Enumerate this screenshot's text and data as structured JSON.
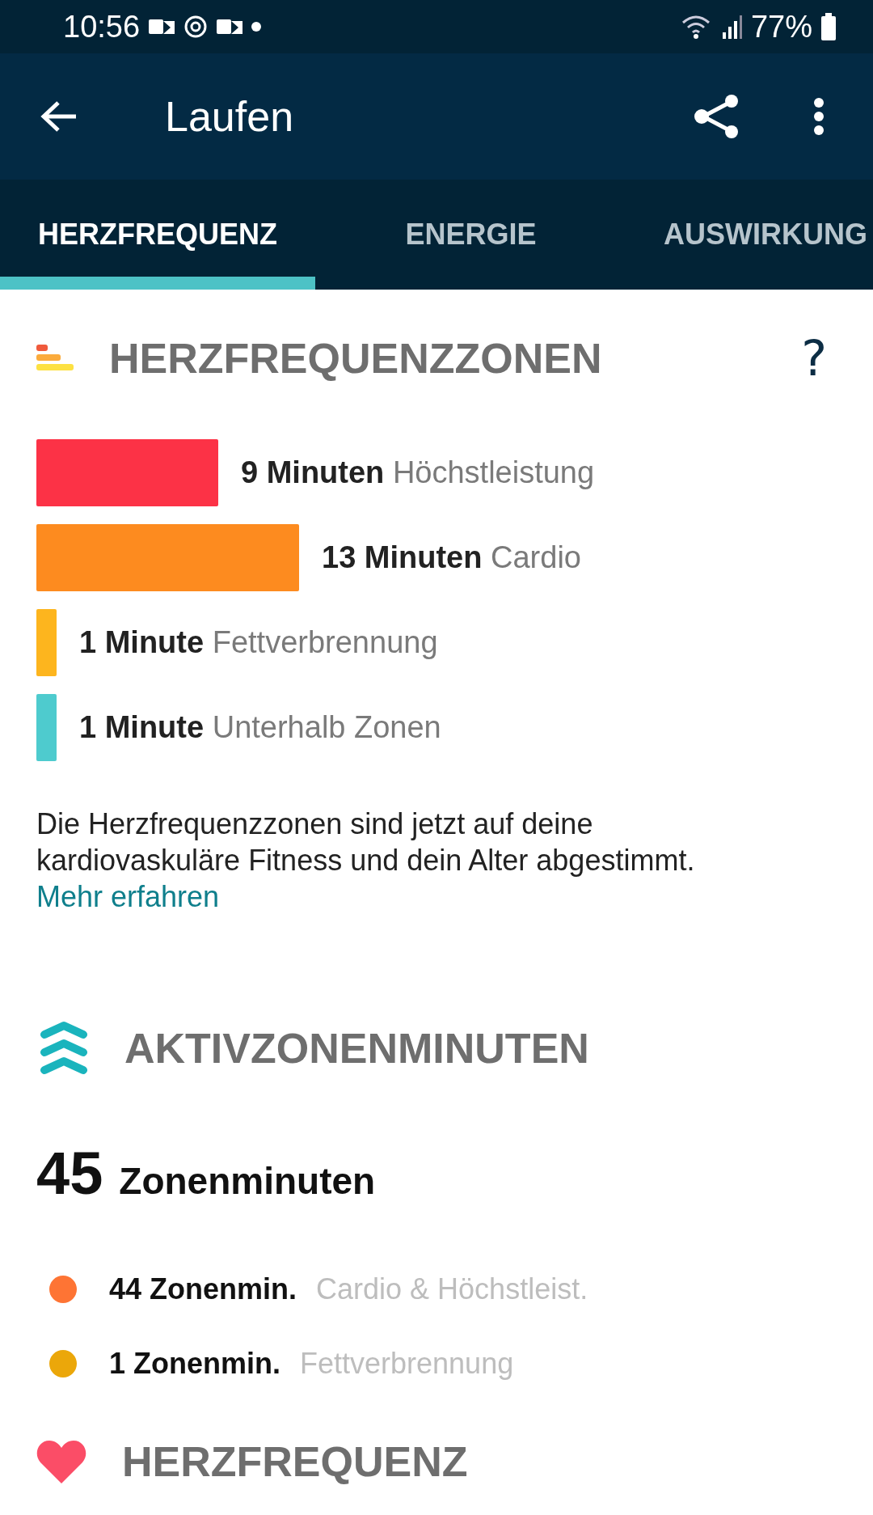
{
  "status_bar": {
    "time": "10:56",
    "battery": "77%"
  },
  "app_bar": {
    "title": "Laufen"
  },
  "tabs": [
    {
      "label": "HERZFREQUENZ",
      "selected": true
    },
    {
      "label": "ENERGIE",
      "selected": false
    },
    {
      "label": "AUSWIRKUNG",
      "selected": false
    }
  ],
  "heart_rate_zones": {
    "title": "HERZFREQUENZZONEN",
    "help": "?",
    "zones": [
      {
        "amount": "9 Minuten",
        "name": "Höchstleistung",
        "color": "#fc3246"
      },
      {
        "amount": "13 Minuten",
        "name": "Cardio",
        "color": "#fd8b1f"
      },
      {
        "amount": "1 Minute",
        "name": "Fettverbrennung",
        "color": "#fdb51e"
      },
      {
        "amount": "1 Minute",
        "name": "Unterhalb Zonen",
        "color": "#4ecbce"
      }
    ],
    "note": "Die Herzfrequenzzonen sind jetzt auf deine kardiovaskuläre Fitness und dein Alter abgestimmt.",
    "link": "Mehr erfahren"
  },
  "active_zone_minutes": {
    "title": "AKTIVZONENMINUTEN",
    "total": "45",
    "unit": "Zonenminuten",
    "items": [
      {
        "amount": "44 Zonenmin.",
        "name": "Cardio & Höchstleist.",
        "color": "#fe7434"
      },
      {
        "amount": "1 Zonenmin.",
        "name": "Fettverbrennung",
        "color": "#eba70a"
      }
    ]
  },
  "heart_rate": {
    "title": "HERZFREQUENZ"
  }
}
